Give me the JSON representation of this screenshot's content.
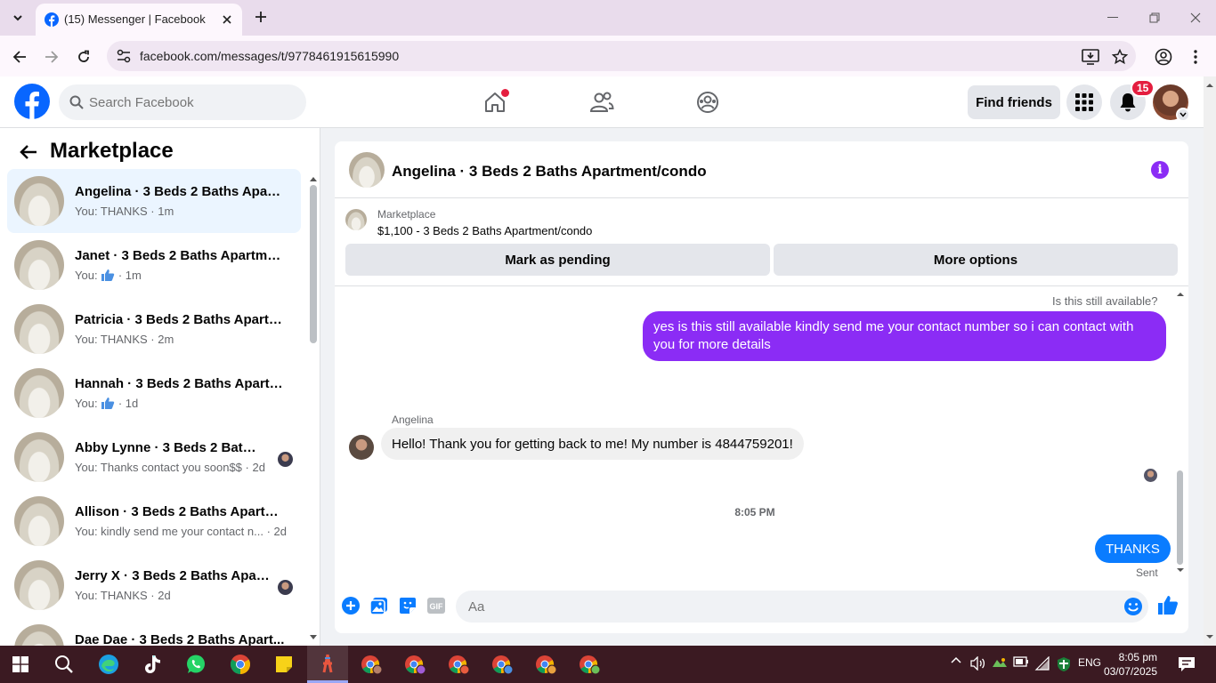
{
  "browser": {
    "tab_title": "(15) Messenger | Facebook",
    "url": "facebook.com/messages/t/9778461915615990"
  },
  "fb_header": {
    "search_placeholder": "Search Facebook",
    "find_friends_label": "Find friends",
    "notification_count": "15"
  },
  "sidebar": {
    "title": "Marketplace",
    "conversations": [
      {
        "name": "Angelina · 3 Beds 2 Baths Apart...",
        "preview": "You: THANKS · 1m",
        "active": true
      },
      {
        "name": "Janet · 3 Beds 2 Baths Apartmen...",
        "preview_prefix": "You:",
        "preview_suffix": "· 1m",
        "like": true
      },
      {
        "name": "Patricia · 3 Beds 2 Baths Apartm...",
        "preview": "You: THANKS · 2m"
      },
      {
        "name": "Hannah · 3 Beds 2 Baths Apartm...",
        "preview_prefix": "You:",
        "preview_suffix": "· 1d",
        "like": true
      },
      {
        "name": "Abby Lynne · 3 Beds 2 Baths ...",
        "preview": "You: Thanks contact you soon$$ · 2d",
        "seen": true
      },
      {
        "name": "Allison · 3 Beds 2 Baths Apartme...",
        "preview": "You: kindly send me your contact n... · 2d"
      },
      {
        "name": "Jerry X · 3 Beds 2 Baths Apart...",
        "preview": "You: THANKS · 2d",
        "seen": true
      },
      {
        "name": "Dae Dae · 3 Beds 2 Baths Apart...",
        "preview": ""
      }
    ]
  },
  "chat": {
    "title": "Angelina · 3 Beds 2 Baths Apartment/condo",
    "marketplace_label": "Marketplace",
    "listing": "$1,100 - 3 Beds 2 Baths Apartment/condo",
    "mark_pending_label": "Mark as pending",
    "more_options_label": "More options",
    "reply_context": "Is this still available?",
    "outgoing_message": "yes is this still available kindly send me your contact number so i can contact with you for more details",
    "sender_name": "Angelina",
    "incoming_message": "Hello! Thank you for getting back to me! My number is 4844759201!",
    "timestamp": "8:05 PM",
    "last_message": "THANKS",
    "status": "Sent",
    "composer_placeholder": "Aa"
  },
  "taskbar": {
    "language": "ENG",
    "time": "8:05 pm",
    "date": "03/07/2025"
  },
  "colors": {
    "facebook_blue": "#0866ff",
    "outgoing_bubble": "#8b2cf5",
    "sent_bubble": "#0a7cff",
    "notification_red": "#e41e3f",
    "taskbar_bg": "#3b1a22"
  }
}
